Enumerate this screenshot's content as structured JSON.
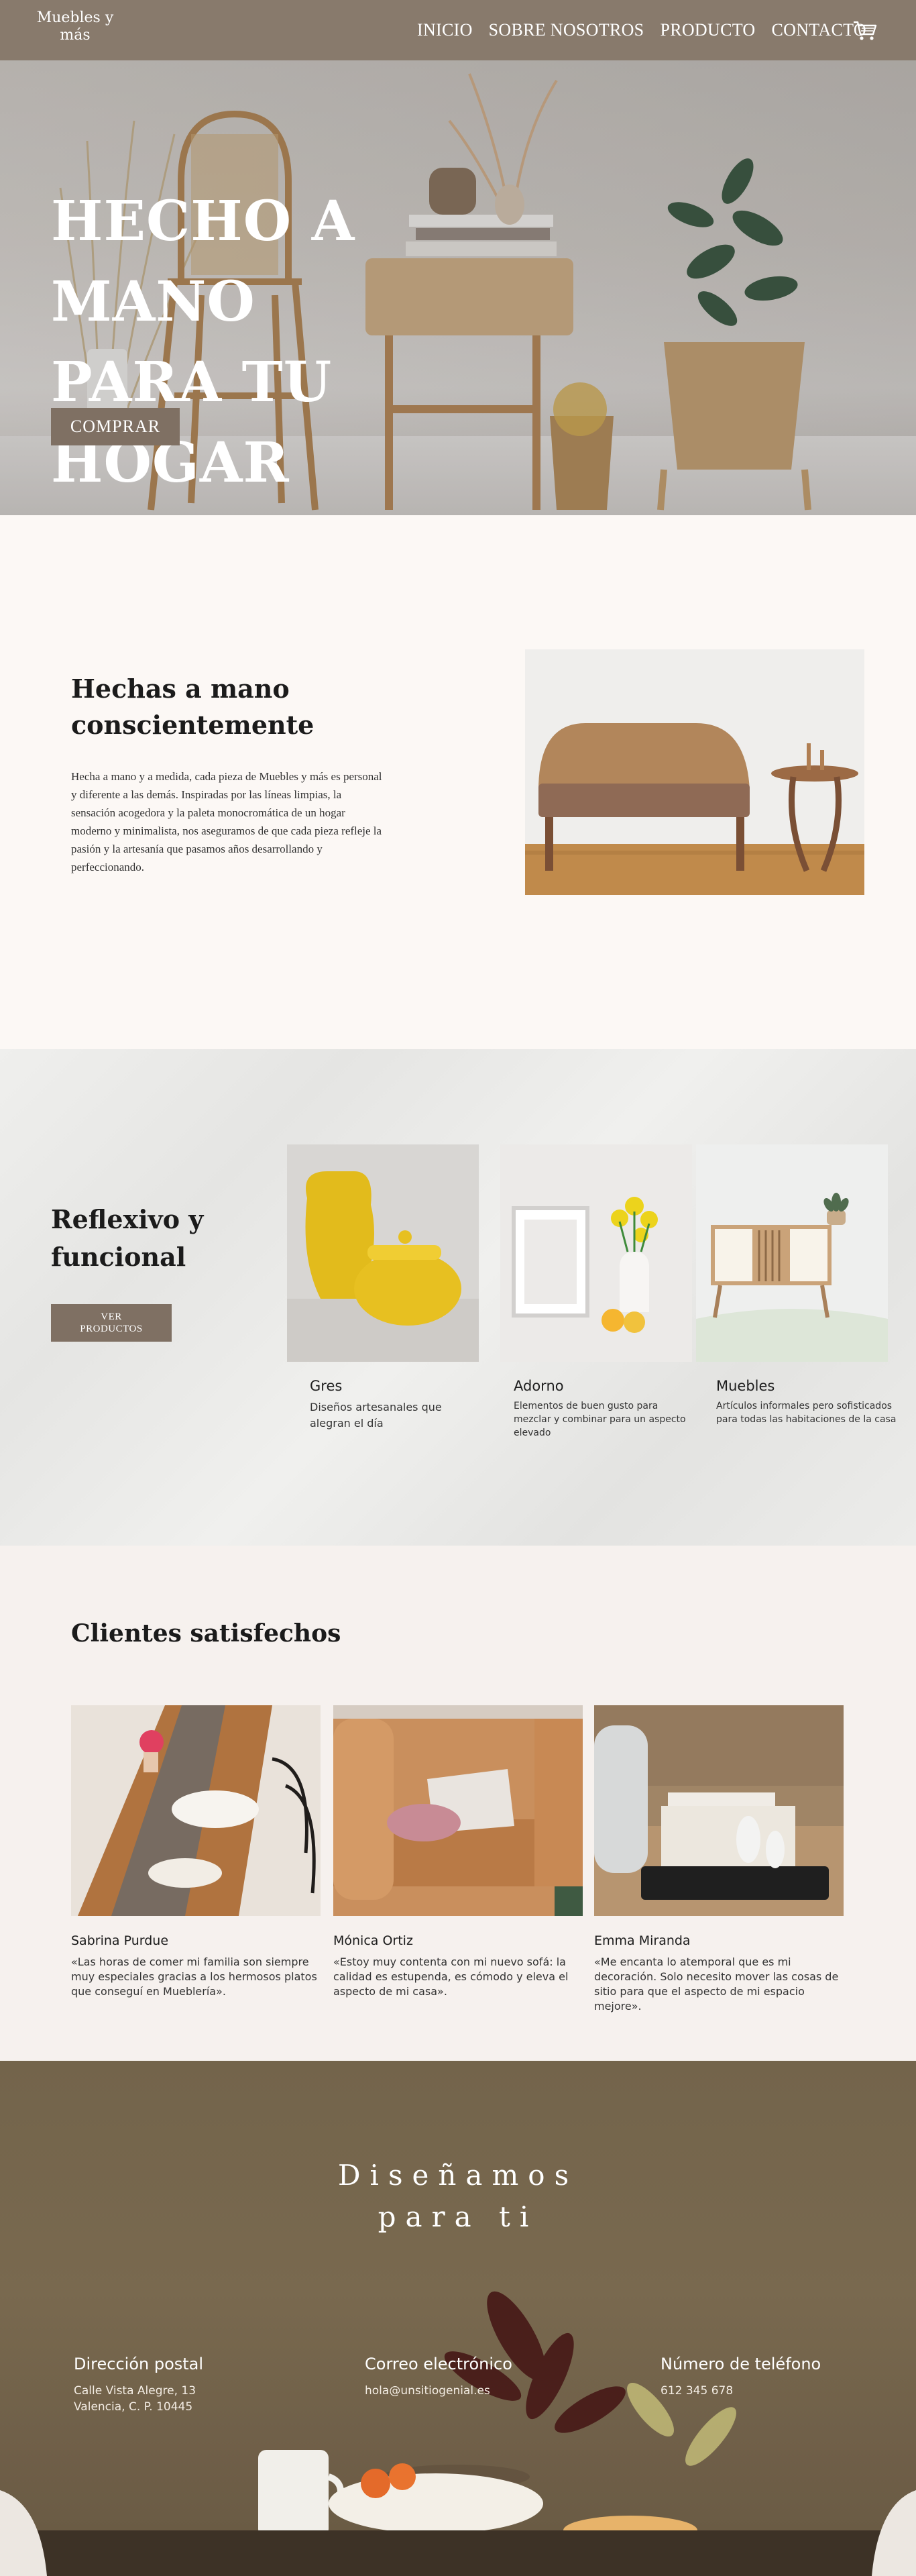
{
  "header": {
    "logo_line1": "Muebles y",
    "logo_line2": "más",
    "nav": [
      "INICIO",
      "SOBRE NOSOTROS",
      "PRODUCTO",
      "CONTACTO"
    ],
    "cart_icon": "shopping-cart-icon"
  },
  "hero": {
    "title_line1": "HECHO A MANO",
    "title_line2": "PARA TU HOGAR",
    "button_label": "COMPRAR"
  },
  "about": {
    "heading_line1": "Hechas a mano",
    "heading_line2": "conscientemente",
    "paragraph": "Hecha a mano y a medida, cada pieza de Muebles y más es personal y diferente a las demás. Inspiradas por las líneas limpias, la sensación acogedora y la paleta monocromática de un hogar moderno y minimalista, nos aseguramos de que cada pieza refleje la pasión y la artesanía que pasamos años desarrollando y perfeccionando."
  },
  "categories": {
    "heading_line1": "Reflexivo y",
    "heading_line2": "funcional",
    "button_line1": "VER",
    "button_line2": "PRODUCTOS",
    "items": [
      {
        "name": "Gres",
        "desc": "Diseños artesanales que alegran el día"
      },
      {
        "name": "Adorno",
        "desc": "Elementos de buen gusto para mezclar y combinar para un aspecto elevado"
      },
      {
        "name": "Muebles",
        "desc": "Artículos informales pero sofisticados para todas las habitaciones de la casa"
      }
    ]
  },
  "testimonials": {
    "heading": "Clientes satisfechos",
    "items": [
      {
        "name": "Sabrina Purdue",
        "quote": "«Las horas de comer mi familia son siempre muy especiales gracias a los hermosos platos que conseguí en Mueblería»."
      },
      {
        "name": "Mónica Ortiz",
        "quote": "«Estoy muy contenta con mi nuevo sofá: la calidad es estupenda, es cómodo y eleva el aspecto de mi casa»."
      },
      {
        "name": "Emma Miranda",
        "quote": "«Me encanta lo atemporal que es mi decoración. Solo necesito mover las cosas de sitio para que el aspecto de mi espacio mejore»."
      }
    ]
  },
  "footer": {
    "title_line1": "Diseñamos",
    "title_line2": "para ti",
    "address_label": "Dirección postal",
    "address_line1": "Calle Vista Alegre, 13",
    "address_line2": "Valencia, C. P. 10445",
    "email_label": "Correo electrónico",
    "email": "hola@unsitiogenial.es",
    "phone_label": "Número de teléfono",
    "phone": "612 345 678"
  },
  "colors": {
    "header_bg": "#887a6c",
    "button_bg": "#7f7063",
    "page_bg": "#fcf8f5",
    "footer_bg": "#7a6a50"
  }
}
